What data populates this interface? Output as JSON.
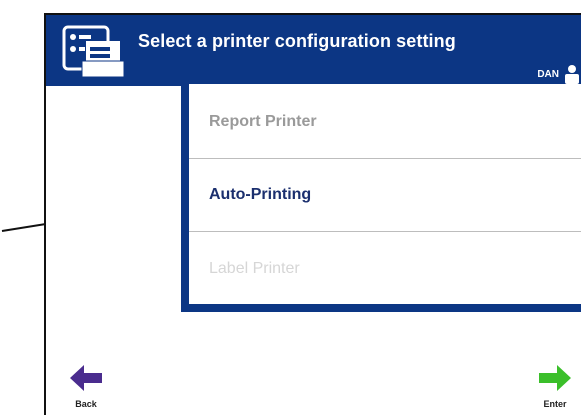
{
  "header": {
    "title": "Select a printer configuration setting",
    "user": "DAN"
  },
  "menu": {
    "items": [
      {
        "label": "Report Printer",
        "state": "dimmed"
      },
      {
        "label": "Auto-Printing",
        "state": "active"
      },
      {
        "label": "Label Printer",
        "state": "disabled"
      }
    ]
  },
  "footer": {
    "back_label": "Back",
    "enter_label": "Enter"
  },
  "colors": {
    "header_bg": "#0c3684",
    "active_text": "#1b2f6e",
    "back_arrow": "#4a2c8e",
    "enter_arrow": "#3bbf2a"
  },
  "icons": {
    "header": "printer-config-icon",
    "user": "user-icon",
    "back": "arrow-left-icon",
    "enter": "arrow-right-icon",
    "callout": "callout-arrow"
  }
}
